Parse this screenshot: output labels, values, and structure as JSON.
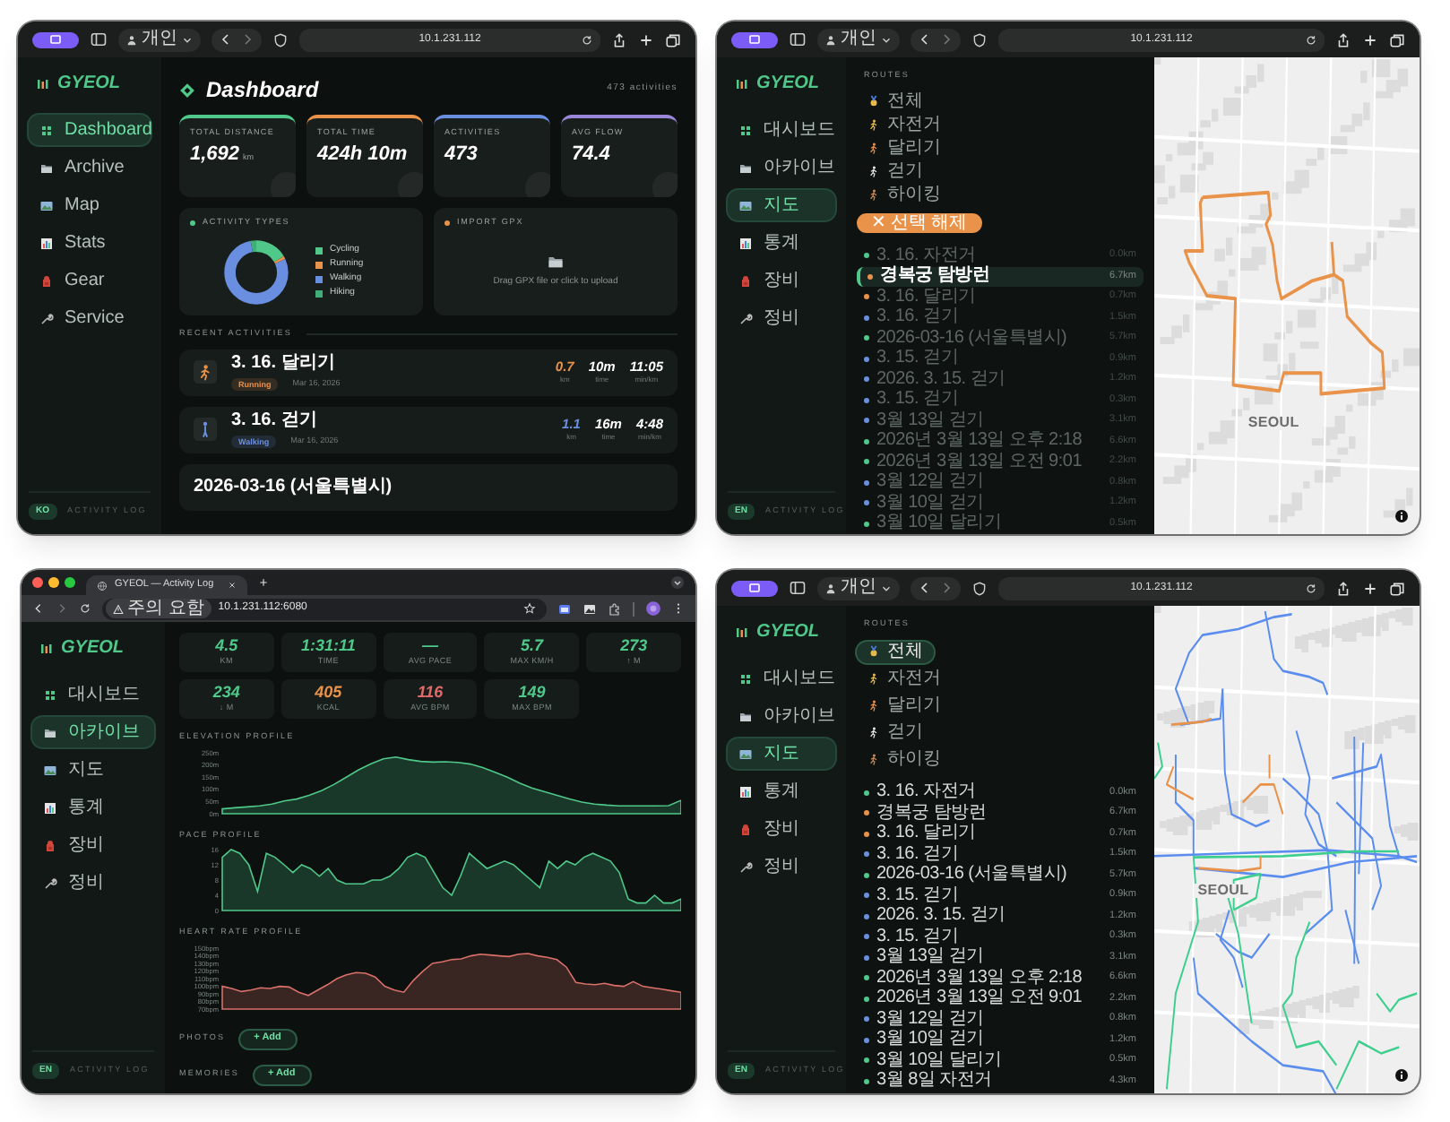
{
  "windows": [
    {
      "kind": "dashboard",
      "browser": {
        "kind": "safari",
        "profile": "개인",
        "url": "10.1.231.112"
      },
      "sidebar": {
        "logo": "GYEOL",
        "items": [
          {
            "kind": "dashboard",
            "label": "Dashboard",
            "selected": true
          },
          {
            "kind": "archive",
            "label": "Archive",
            "selected": false
          },
          {
            "kind": "map",
            "label": "Map",
            "selected": false
          },
          {
            "kind": "stats",
            "label": "Stats",
            "selected": false
          },
          {
            "kind": "gear",
            "label": "Gear",
            "selected": false
          },
          {
            "kind": "service",
            "label": "Service",
            "selected": false
          }
        ],
        "language": "KO",
        "footer": "ACTIVITY LOG"
      },
      "main": {
        "title": "Dashboard",
        "count": "473 activities",
        "stats": [
          {
            "label": "TOTAL DISTANCE",
            "value": "1,692",
            "unit": "km",
            "color": "#4fc88a"
          },
          {
            "label": "TOTAL TIME",
            "value": "424h 10m",
            "color": "#e8924a"
          },
          {
            "label": "ACTIVITIES",
            "value": "473",
            "color": "#6b8fe0"
          },
          {
            "label": "AVG FLOW",
            "value": "74.4",
            "color": "#9a86d8"
          }
        ],
        "activity_types": {
          "title": "ACTIVITY TYPES",
          "legend": [
            {
              "label": "Cycling",
              "color": "#4fc88a"
            },
            {
              "label": "Running",
              "color": "#e8924a"
            },
            {
              "label": "Walking",
              "color": "#6b8fe0"
            },
            {
              "label": "Hiking",
              "color": "#3fae78"
            }
          ]
        },
        "import_gpx": {
          "title": "IMPORT GPX",
          "hint": "Drag GPX file or click to upload"
        },
        "recent": {
          "title": "RECENT ACTIVITIES",
          "items": [
            {
              "kind": "running",
              "title": "3. 16. 달리기",
              "tag": "Running",
              "date": "Mar 16, 2026",
              "color": "#e8924a",
              "metrics": [
                {
                  "value": "0.7",
                  "unit": "km"
                },
                {
                  "value": "10m",
                  "unit": "time"
                },
                {
                  "value": "11:05",
                  "unit": "min/km"
                }
              ]
            },
            {
              "kind": "walking",
              "title": "3. 16. 걷기",
              "tag": "Walking",
              "date": "Mar 16, 2026",
              "color": "#6b8fe0",
              "metrics": [
                {
                  "value": "1.1",
                  "unit": "km"
                },
                {
                  "value": "16m",
                  "unit": "time"
                },
                {
                  "value": "4:48",
                  "unit": "min/km"
                }
              ]
            },
            {
              "title": "2026-03-16 (서울특별시)"
            }
          ]
        }
      }
    },
    {
      "kind": "map",
      "browser": {
        "kind": "safari",
        "profile": "개인",
        "url": "10.1.231.112"
      },
      "sidebar": {
        "logo": "GYEOL",
        "items": [
          {
            "kind": "dashboard",
            "label": "대시보드",
            "selected": false
          },
          {
            "kind": "archive",
            "label": "아카이브",
            "selected": false
          },
          {
            "kind": "map",
            "label": "지도",
            "selected": true
          },
          {
            "kind": "stats",
            "label": "통계",
            "selected": false
          },
          {
            "kind": "gear",
            "label": "장비",
            "selected": false
          },
          {
            "kind": "service",
            "label": "정비",
            "selected": false
          }
        ],
        "language": "EN",
        "footer": "ACTIVITY LOG"
      },
      "routes": {
        "title": "ROUTES",
        "filters": [
          {
            "kind": "all",
            "label": "전체",
            "selected": false
          },
          {
            "kind": "cycling",
            "label": "자전거",
            "selected": false
          },
          {
            "kind": "running",
            "label": "달리기",
            "selected": false
          },
          {
            "kind": "walking",
            "label": "걷기",
            "selected": false
          },
          {
            "kind": "hiking",
            "label": "하이킹",
            "selected": false
          }
        ],
        "clear_button": "✕ 선택 해제",
        "items": [
          {
            "name": "3. 16. 자전거",
            "distance": "0.0km",
            "color": "#4fc88a",
            "selected": false
          },
          {
            "name": "경복궁 탐방런",
            "distance": "6.7km",
            "color": "#e8924a",
            "selected": true
          },
          {
            "name": "3. 16. 달리기",
            "distance": "0.7km",
            "color": "#e8924a",
            "selected": false
          },
          {
            "name": "3. 16. 걷기",
            "distance": "1.5km",
            "color": "#6b8fe0",
            "selected": false
          },
          {
            "name": "2026-03-16 (서울특별시)",
            "distance": "5.7km",
            "color": "#4fc88a",
            "selected": false
          },
          {
            "name": "3. 15. 걷기",
            "distance": "0.9km",
            "color": "#6b8fe0",
            "selected": false
          },
          {
            "name": "2026. 3. 15. 걷기",
            "distance": "1.2km",
            "color": "#6b8fe0",
            "selected": false
          },
          {
            "name": "3. 15. 걷기",
            "distance": "0.3km",
            "color": "#6b8fe0",
            "selected": false
          },
          {
            "name": "3월 13일 걷기",
            "distance": "3.1km",
            "color": "#6b8fe0",
            "selected": false
          },
          {
            "name": "2026년 3월 13일 오후 2:18",
            "distance": "6.6km",
            "color": "#4fc88a",
            "selected": false
          },
          {
            "name": "2026년 3월 13일 오전 9:01",
            "distance": "2.2km",
            "color": "#4fc88a",
            "selected": false
          },
          {
            "name": "3월 12일 걷기",
            "distance": "0.8km",
            "color": "#6b8fe0",
            "selected": false
          },
          {
            "name": "3월 10일 걷기",
            "distance": "1.2km",
            "color": "#6b8fe0",
            "selected": false
          },
          {
            "name": "3월 10일 달리기",
            "distance": "0.5km",
            "color": "#4fc88a",
            "selected": false
          }
        ]
      },
      "map": {
        "kind": "single_route",
        "label": "SEOUL"
      }
    },
    {
      "kind": "activity",
      "browser": {
        "kind": "chrome",
        "tab_title": "GYEOL — Activity Log",
        "security": "주의 요함",
        "url": "10.1.231.112:6080"
      },
      "sidebar": {
        "logo": "GYEOL",
        "items": [
          {
            "kind": "dashboard",
            "label": "대시보드",
            "selected": false
          },
          {
            "kind": "archive",
            "label": "아카이브",
            "selected": true
          },
          {
            "kind": "map",
            "label": "지도",
            "selected": false
          },
          {
            "kind": "stats",
            "label": "통계",
            "selected": false
          },
          {
            "kind": "gear",
            "label": "장비",
            "selected": false
          },
          {
            "kind": "service",
            "label": "정비",
            "selected": false
          }
        ],
        "language": "EN",
        "footer": "ACTIVITY LOG"
      },
      "main": {
        "stats": [
          {
            "value": "4.5",
            "label": "KM",
            "color": "#4fc88a"
          },
          {
            "value": "1:31:11",
            "label": "TIME",
            "color": "#4fc88a"
          },
          {
            "value": "—",
            "label": "AVG PACE",
            "color": "#4fc88a"
          },
          {
            "value": "5.7",
            "label": "MAX KM/H",
            "color": "#4fc88a"
          },
          {
            "value": "273",
            "label": "↑ M",
            "color": "#4fc88a"
          },
          {
            "value": "234",
            "label": "↓ M",
            "color": "#4fc88a"
          },
          {
            "value": "405",
            "label": "KCAL",
            "color": "#e8924a"
          },
          {
            "value": "116",
            "label": "AVG BPM",
            "color": "#e06a6a"
          },
          {
            "value": "149",
            "label": "MAX BPM",
            "color": "#4fc88a"
          }
        ],
        "charts": [
          {
            "chart_data": {
              "type": "area",
              "title": "ELEVATION PROFILE",
              "ylim": [
                0,
                250
              ],
              "yticks": [
                {
                  "value": 0,
                  "label": "0m"
                },
                {
                  "value": 50,
                  "label": "50m"
                },
                {
                  "value": 100,
                  "label": "100m"
                },
                {
                  "value": 150,
                  "label": "150m"
                },
                {
                  "value": 200,
                  "label": "200m"
                },
                {
                  "value": 250,
                  "label": "250m"
                }
              ],
              "series": [
                {
                  "color": "#4fc88a",
                  "values": [
                    20,
                    24,
                    28,
                    32,
                    40,
                    52,
                    60,
                    75,
                    95,
                    120,
                    150,
                    180,
                    205,
                    225,
                    232,
                    222,
                    215,
                    212,
                    213,
                    210,
                    204,
                    190,
                    170,
                    150,
                    125,
                    105,
                    90,
                    75,
                    60,
                    48,
                    40,
                    35,
                    32,
                    32,
                    32,
                    32,
                    33,
                    55
                  ]
                }
              ]
            }
          },
          {
            "chart_data": {
              "type": "area",
              "title": "PACE PROFILE",
              "ylim": [
                0,
                16
              ],
              "yticks": [
                {
                  "value": 0,
                  "label": "0"
                },
                {
                  "value": 4,
                  "label": "4"
                },
                {
                  "value": 8,
                  "label": "8"
                },
                {
                  "value": 12,
                  "label": "12"
                },
                {
                  "value": 16,
                  "label": "16"
                }
              ],
              "series": [
                {
                  "color": "#4fc88a",
                  "values": [
                    14,
                    16,
                    15,
                    12,
                    5,
                    15,
                    14,
                    12,
                    10,
                    12,
                    11,
                    9,
                    11,
                    8,
                    7,
                    7,
                    7,
                    8,
                    8,
                    9,
                    11,
                    14,
                    15,
                    14,
                    10,
                    6,
                    4,
                    9,
                    15,
                    13,
                    11,
                    12,
                    13,
                    12,
                    10,
                    8,
                    6,
                    13,
                    11,
                    13,
                    12,
                    14,
                    15,
                    14,
                    13,
                    10,
                    3,
                    2,
                    2,
                    4,
                    2,
                    2,
                    3
                  ]
                }
              ]
            }
          },
          {
            "chart_data": {
              "type": "area",
              "title": "HEART RATE PROFILE",
              "ylim": [
                70,
                150
              ],
              "yticks": [
                {
                  "value": 70,
                  "label": "70bpm"
                },
                {
                  "value": 80,
                  "label": "80bpm"
                },
                {
                  "value": 90,
                  "label": "90bpm"
                },
                {
                  "value": 100,
                  "label": "100bpm"
                },
                {
                  "value": 110,
                  "label": "110bpm"
                },
                {
                  "value": 120,
                  "label": "120bpm"
                },
                {
                  "value": 130,
                  "label": "130bpm"
                },
                {
                  "value": 140,
                  "label": "140bpm"
                },
                {
                  "value": 150,
                  "label": "150bpm"
                }
              ],
              "series": [
                {
                  "color": "#d9706a",
                  "values": [
                    100,
                    97,
                    93,
                    95,
                    98,
                    97,
                    100,
                    99,
                    92,
                    88,
                    95,
                    102,
                    110,
                    115,
                    118,
                    117,
                    112,
                    100,
                    95,
                    92,
                    108,
                    120,
                    130,
                    132,
                    135,
                    136,
                    140,
                    142,
                    141,
                    140,
                    139,
                    142,
                    143,
                    140,
                    138,
                    135,
                    125,
                    105,
                    103,
                    102,
                    104,
                    101,
                    100,
                    106,
                    100,
                    98,
                    96,
                    94,
                    92
                  ]
                }
              ]
            }
          }
        ],
        "sections": [
          {
            "title": "PHOTOS",
            "button": "+ Add"
          },
          {
            "title": "MEMORIES",
            "button": "+ Add"
          }
        ]
      }
    },
    {
      "kind": "map",
      "browser": {
        "kind": "safari",
        "profile": "개인",
        "url": "10.1.231.112"
      },
      "sidebar": {
        "logo": "GYEOL",
        "items": [
          {
            "kind": "dashboard",
            "label": "대시보드",
            "selected": false
          },
          {
            "kind": "archive",
            "label": "아카이브",
            "selected": false
          },
          {
            "kind": "map",
            "label": "지도",
            "selected": true
          },
          {
            "kind": "stats",
            "label": "통계",
            "selected": false
          },
          {
            "kind": "gear",
            "label": "장비",
            "selected": false
          },
          {
            "kind": "service",
            "label": "정비",
            "selected": false
          }
        ],
        "language": "EN",
        "footer": "ACTIVITY LOG"
      },
      "routes": {
        "title": "ROUTES",
        "filters": [
          {
            "kind": "all",
            "label": "전체",
            "selected": true
          },
          {
            "kind": "cycling",
            "label": "자전거",
            "selected": false
          },
          {
            "kind": "running",
            "label": "달리기",
            "selected": false
          },
          {
            "kind": "walking",
            "label": "걷기",
            "selected": false
          },
          {
            "kind": "hiking",
            "label": "하이킹",
            "selected": false
          }
        ],
        "items": [
          {
            "name": "3. 16. 자전거",
            "distance": "0.0km",
            "color": "#4fc88a",
            "selected": false
          },
          {
            "name": "경복궁 탐방런",
            "distance": "6.7km",
            "color": "#e8924a",
            "selected": false
          },
          {
            "name": "3. 16. 달리기",
            "distance": "0.7km",
            "color": "#e8924a",
            "selected": false
          },
          {
            "name": "3. 16. 걷기",
            "distance": "1.5km",
            "color": "#6b8fe0",
            "selected": false
          },
          {
            "name": "2026-03-16 (서울특별시)",
            "distance": "5.7km",
            "color": "#4fc88a",
            "selected": false
          },
          {
            "name": "3. 15. 걷기",
            "distance": "0.9km",
            "color": "#6b8fe0",
            "selected": false
          },
          {
            "name": "2026. 3. 15. 걷기",
            "distance": "1.2km",
            "color": "#6b8fe0",
            "selected": false
          },
          {
            "name": "3. 15. 걷기",
            "distance": "0.3km",
            "color": "#6b8fe0",
            "selected": false
          },
          {
            "name": "3월 13일 걷기",
            "distance": "3.1km",
            "color": "#6b8fe0",
            "selected": false
          },
          {
            "name": "2026년 3월 13일 오후 2:18",
            "distance": "6.6km",
            "color": "#4fc88a",
            "selected": false
          },
          {
            "name": "2026년 3월 13일 오전 9:01",
            "distance": "2.2km",
            "color": "#4fc88a",
            "selected": false
          },
          {
            "name": "3월 12일 걷기",
            "distance": "0.8km",
            "color": "#6b8fe0",
            "selected": false
          },
          {
            "name": "3월 10일 걷기",
            "distance": "1.2km",
            "color": "#6b8fe0",
            "selected": false
          },
          {
            "name": "3월 10일 달리기",
            "distance": "0.5km",
            "color": "#4fc88a",
            "selected": false
          },
          {
            "name": "3월 8일 자전거",
            "distance": "4.3km",
            "color": "#4fc88a",
            "selected": false
          }
        ]
      },
      "map": {
        "kind": "all_routes",
        "label": "SEOUL"
      }
    }
  ]
}
